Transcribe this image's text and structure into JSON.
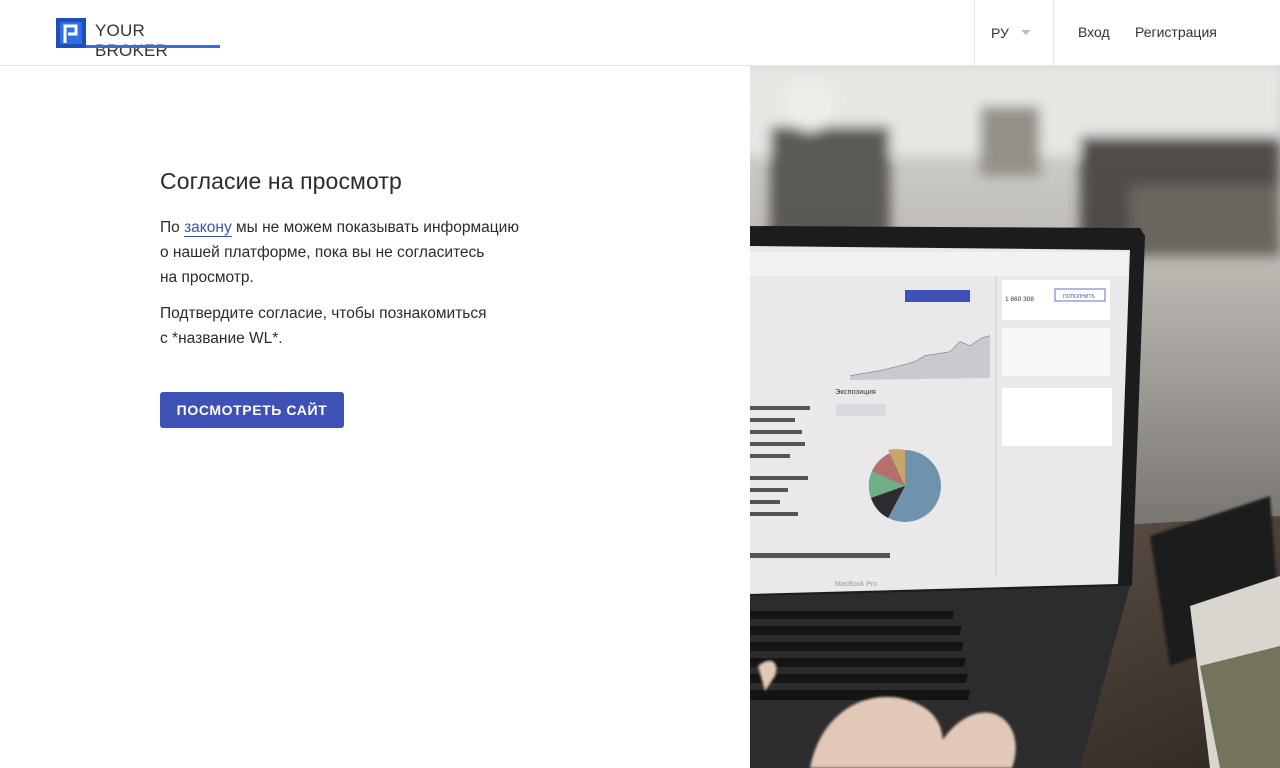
{
  "header": {
    "brand": "YOUR BROKER",
    "language": "РУ",
    "login_label": "Вход",
    "register_label": "Регистрация"
  },
  "consent": {
    "title": "Согласие на просмотр",
    "paragraph1_before": "По ",
    "paragraph1_link": "закону",
    "paragraph1_line1_after": " мы не можем показывать информацию",
    "paragraph1_line2": "о нашей платформе, пока вы не согласитесь",
    "paragraph1_line3": "на просмотр.",
    "paragraph2_line1": "Подтвердите согласие, чтобы познакомиться",
    "paragraph2_line2": "с *название WL*.",
    "button_label": "ПОСМОТРЕТЬ САЙТ"
  },
  "hero": {
    "laptop_brand": "MacBook Pro",
    "screen_heading": "Экспозиция",
    "screen_button": "ПОПОЛНИТЬ",
    "screen_value": "1 860 308"
  },
  "colors": {
    "accent": "#3f51b5",
    "logo_blue": "#2f6fe0"
  }
}
